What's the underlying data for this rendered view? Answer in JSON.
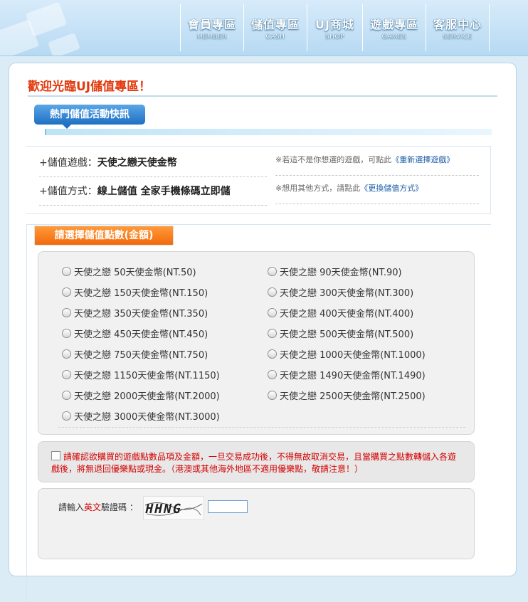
{
  "nav": [
    {
      "cn": "會員專區",
      "en": "MEMBER"
    },
    {
      "cn": "儲值專區",
      "en": "CASH"
    },
    {
      "cn": "UJ商城",
      "en": "SHOP"
    },
    {
      "cn": "遊戲專區",
      "en": "GAMES"
    },
    {
      "cn": "客服中心",
      "en": "SERVICE"
    }
  ],
  "welcome_title": "歡迎光臨UJ儲值專區！",
  "hot_tag": "熱門儲值活動快訊",
  "game_row": {
    "label": "+儲值遊戲：",
    "value": "天使之戀天使金幣"
  },
  "method_row": {
    "label": "+儲值方式：",
    "value": "線上儲值 全家手機條碼立即儲"
  },
  "game_note": {
    "text": "※若這不是你想選的遊戲，可點此",
    "link": "《重新選擇遊戲》"
  },
  "method_note": {
    "text": "※想用其他方式，請點此",
    "link": "《更換儲值方式》"
  },
  "select_tag": "請選擇儲值點數(金額)",
  "amounts_left": [
    "天使之戀 50天使金幣(NT.50)",
    "天使之戀 150天使金幣(NT.150)",
    "天使之戀 350天使金幣(NT.350)",
    "天使之戀 450天使金幣(NT.450)",
    "天使之戀 750天使金幣(NT.750)",
    "天使之戀 1150天使金幣(NT.1150)",
    "天使之戀 2000天使金幣(NT.2000)",
    "天使之戀 3000天使金幣(NT.3000)"
  ],
  "amounts_right": [
    "天使之戀 90天使金幣(NT.90)",
    "天使之戀 300天使金幣(NT.300)",
    "天使之戀 400天使金幣(NT.400)",
    "天使之戀 500天使金幣(NT.500)",
    "天使之戀 1000天使金幣(NT.1000)",
    "天使之戀 1490天使金幣(NT.1490)",
    "天使之戀 2500天使金幣(NT.2500)"
  ],
  "warning": "請確認欲購買的遊戲點數品項及金額，一旦交易成功後，不得無故取消交易，且當購買之點數轉儲入各遊戲後，將無退回優樂點或現金。（港澳或其他海外地區不適用優樂點，敬請注意！）",
  "captcha": {
    "label_pre": "請輸入",
    "label_hl": "英文",
    "label_post": "驗證碼 ：",
    "image_text": "HHNG"
  },
  "colors": {
    "accent_red": "#e33a0e",
    "warn_red": "#d40000",
    "tag_blue": "#1f6fc4",
    "tag_orange": "#f26a0c"
  }
}
